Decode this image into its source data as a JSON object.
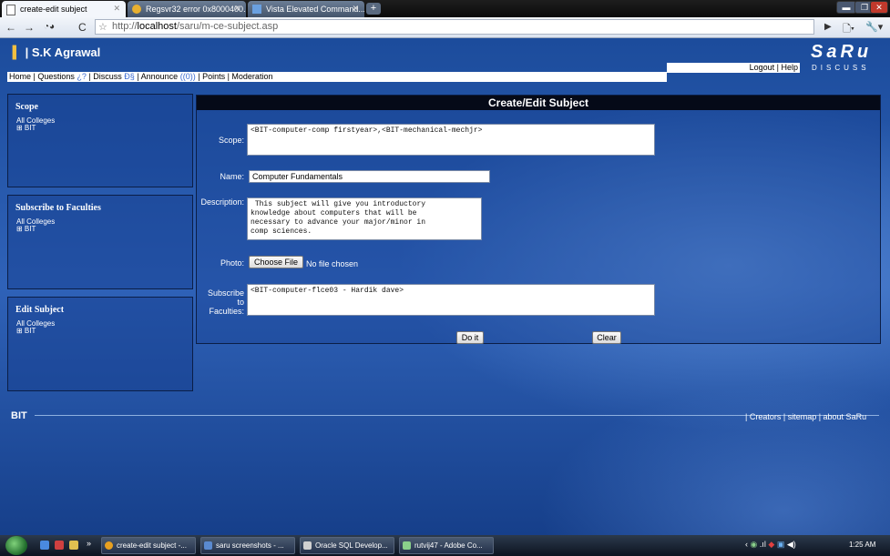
{
  "browser": {
    "tabs": [
      {
        "title": "create-edit subject",
        "active": true
      },
      {
        "title": "Regsvr32 error 0x8000400...",
        "active": false
      },
      {
        "title": "Vista Elevated Command...",
        "active": false
      }
    ],
    "new_tab_label": "+",
    "url_host": "localhost",
    "url_prefix": "http://",
    "url_path": "/saru/m-ce-subject.asp"
  },
  "header": {
    "user": "| S.K Agrawal",
    "logo": "SaRu",
    "logo_sub": "DISCUSS",
    "logout": "Logout",
    "help": "Help"
  },
  "menu": {
    "home": "Home",
    "questions": "Questions",
    "questions_icon": "¿?",
    "discuss": "Discuss",
    "discuss_icon": "Ð§",
    "announce": "Announce",
    "announce_icon": "((0))",
    "points": "Points",
    "moderation": "Moderation"
  },
  "sidebar": {
    "panels": [
      {
        "title": "Scope",
        "sub1": "All Colleges",
        "sub2": "⊞ BIT"
      },
      {
        "title": "Subscribe to Faculties",
        "sub1": "All Colleges",
        "sub2": "⊞ BIT"
      },
      {
        "title": "Edit Subject",
        "sub1": "All Colleges",
        "sub2": "⊞ BIT"
      }
    ]
  },
  "form": {
    "title": "Create/Edit Subject",
    "scope_label": "Scope:",
    "scope_value": "<BIT-computer-comp firstyear>,<BIT-mechanical-mechjr>",
    "name_label": "Name:",
    "name_value": "Computer Fundamentals",
    "description_label": "Description:",
    "description_value": " This subject will give you introductory\nknowledge about computers that will be\nnecessary to advance your major/minor in\ncomp sciences.",
    "photo_label": "Photo:",
    "choose_file": "Choose File",
    "no_file": "No file chosen",
    "subscribe_label_1": "Subscribe",
    "subscribe_label_2": "to",
    "subscribe_label_3": "Faculties:",
    "subscribe_value": "<BIT-computer-flce03 - Hardik dave>",
    "do_it": "Do it",
    "clear": "Clear"
  },
  "footer": {
    "left": "BIT",
    "right": "| Creators | sitemap | about SaRu"
  },
  "taskbar": {
    "items": [
      {
        "label": "create-edit subject -...",
        "color": "#e8a020"
      },
      {
        "label": "saru screenshots - ...",
        "color": "#5a8ad0"
      },
      {
        "label": "Oracle SQL Develop...",
        "color": "#d0d0d0"
      },
      {
        "label": "rutvij47 - Adobe Co...",
        "color": "#8ad08a"
      }
    ],
    "clock": "1:25 AM"
  }
}
